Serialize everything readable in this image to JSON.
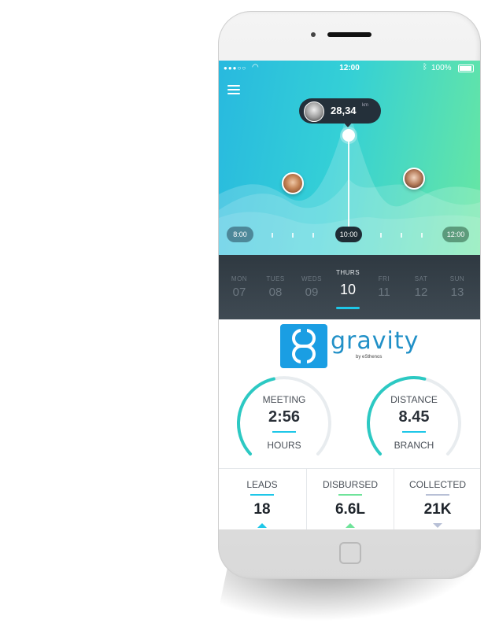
{
  "status_bar": {
    "time": "12:00",
    "battery": "100%"
  },
  "hero": {
    "tooltip_value": "28,34",
    "tooltip_unit": "km",
    "times": {
      "start": "8:00",
      "current": "10:00",
      "end": "12:00"
    }
  },
  "days": [
    {
      "name": "MON",
      "num": "07"
    },
    {
      "name": "TUES",
      "num": "08"
    },
    {
      "name": "WEDS",
      "num": "09"
    },
    {
      "name": "THURS",
      "num": "10",
      "active": true
    },
    {
      "name": "FRI",
      "num": "11"
    },
    {
      "name": "SAT",
      "num": "12"
    },
    {
      "name": "SUN",
      "num": "13"
    }
  ],
  "logo": {
    "word": "gravity",
    "byline": "by eSthenos"
  },
  "gauges": [
    {
      "label": "MEETING",
      "value": "2:56",
      "unit": "HOURS",
      "fraction": 0.45
    },
    {
      "label": "DISTANCE",
      "value": "8.45",
      "unit": "BRANCH",
      "fraction": 0.55
    }
  ],
  "stats": [
    {
      "label": "LEADS",
      "value": "18",
      "trend": "up",
      "color": "#1ec7e8"
    },
    {
      "label": "DISBURSED",
      "value": "6.6L",
      "trend": "up",
      "color": "#6fe39a"
    },
    {
      "label": "COLLECTED",
      "value": "21K",
      "trend": "down",
      "color": "#b8c0d6"
    }
  ],
  "colors": {
    "accent": "#1ec7e8",
    "green": "#6fe39a",
    "dark": "#2f3941"
  }
}
